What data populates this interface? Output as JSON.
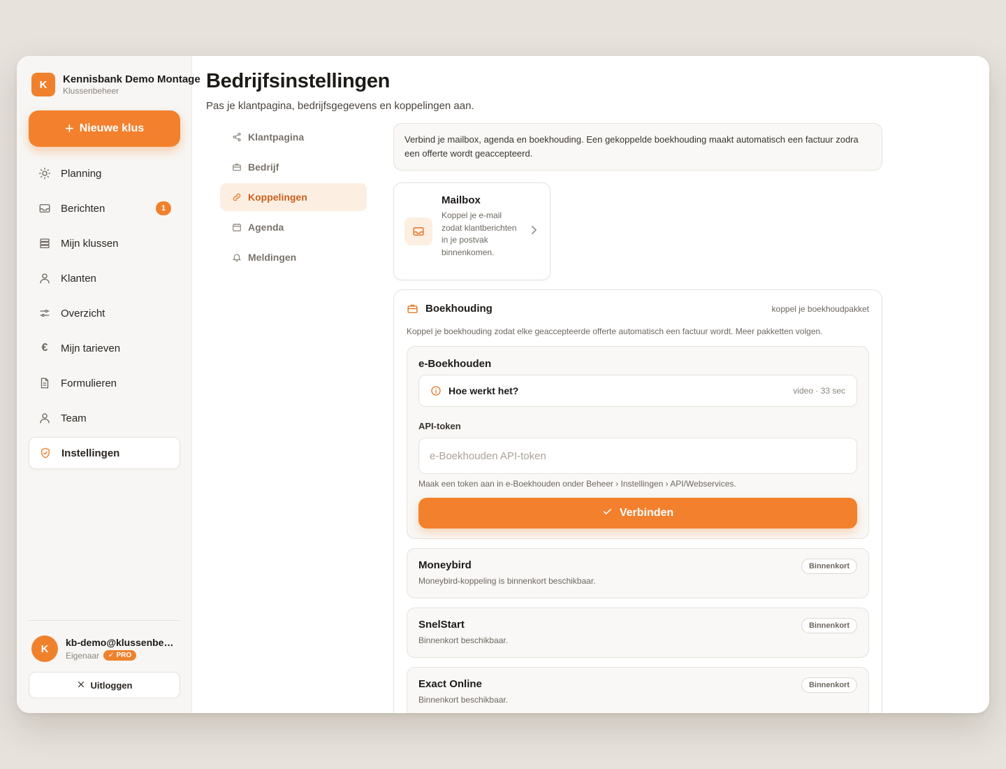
{
  "brand": {
    "initial": "K",
    "name": "Kennisbank Demo Montage",
    "subtitle": "Klussenbeheer"
  },
  "new_button": {
    "label": "Nieuwe klus"
  },
  "nav": [
    {
      "label": "Planning",
      "icon": "sun-icon"
    },
    {
      "label": "Berichten",
      "icon": "inbox-icon",
      "badge": "1"
    },
    {
      "label": "Mijn klussen",
      "icon": "stack-icon"
    },
    {
      "label": "Klanten",
      "icon": "user-icon"
    },
    {
      "label": "Overzicht",
      "icon": "sliders-icon"
    },
    {
      "label": "Mijn tarieven",
      "icon": "euro-icon"
    },
    {
      "label": "Formulieren",
      "icon": "document-icon"
    },
    {
      "label": "Team",
      "icon": "user-icon"
    },
    {
      "label": "Instellingen",
      "icon": "shield-icon",
      "active": true
    }
  ],
  "user": {
    "initial": "K",
    "email": "kb-demo@klussenbeheer.nl",
    "role": "Eigenaar",
    "plan": "PRO"
  },
  "logout": {
    "label": "Uitloggen"
  },
  "page": {
    "title": "Bedrijfsinstellingen",
    "subtitle": "Pas je klantpagina, bedrijfsgegevens en koppelingen aan."
  },
  "subnav": [
    {
      "label": "Klantpagina",
      "icon": "share-icon"
    },
    {
      "label": "Bedrijf",
      "icon": "briefcase-icon"
    },
    {
      "label": "Koppelingen",
      "icon": "link-icon",
      "active": true
    },
    {
      "label": "Agenda",
      "icon": "calendar-icon"
    },
    {
      "label": "Meldingen",
      "icon": "bell-icon"
    }
  ],
  "intro": "Verbind je mailbox, agenda en boekhouding. Een gekoppelde boekhouding maakt automatisch een factuur zodra een offerte wordt geaccepteerd.",
  "mailbox": {
    "title": "Mailbox",
    "description": "Koppel je e-mail zodat klantberichten in je postvak binnenkomen."
  },
  "bookkeeping": {
    "title": "Boekhouding",
    "link": "koppel je boekhoudpakket",
    "description": "Koppel je boekhouding zodat elke geaccepteerde offerte automatisch een factuur wordt. Meer pakketten volgen.",
    "eboekhouden": {
      "name": "e-Boekhouden",
      "howto_label": "Hoe werkt het?",
      "howto_meta": "video · 33 sec",
      "token_label": "API-token",
      "token_placeholder": "e-Boekhouden API-token",
      "token_hint": "Maak een token aan in e-Boekhouden onder Beheer › Instellingen › API/Webservices.",
      "connect_label": "Verbinden"
    },
    "upcoming": [
      {
        "name": "Moneybird",
        "description": "Moneybird-koppeling is binnenkort beschikbaar.",
        "badge": "Binnenkort"
      },
      {
        "name": "SnelStart",
        "description": "Binnenkort beschikbaar.",
        "badge": "Binnenkort"
      },
      {
        "name": "Exact Online",
        "description": "Binnenkort beschikbaar.",
        "badge": "Binnenkort"
      }
    ]
  },
  "colors": {
    "accent": "#f2802c",
    "accent_soft": "#fdeee2",
    "background": "#e7e2dc"
  }
}
